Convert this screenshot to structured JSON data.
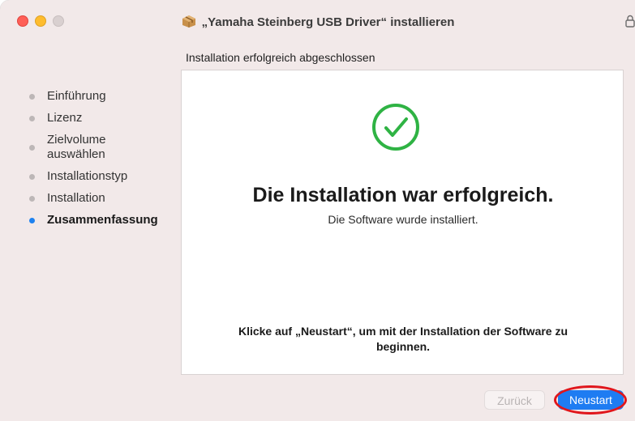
{
  "window": {
    "title": "„Yamaha Steinberg USB Driver“ installieren",
    "package_icon": "package-icon",
    "lock_icon": "lock-icon"
  },
  "subtitle": "Installation erfolgreich abgeschlossen",
  "sidebar": {
    "steps": [
      {
        "label": "Einführung",
        "state": "done"
      },
      {
        "label": "Lizenz",
        "state": "done"
      },
      {
        "label": "Zielvolume auswählen",
        "state": "done"
      },
      {
        "label": "Installationstyp",
        "state": "done"
      },
      {
        "label": "Installation",
        "state": "done"
      },
      {
        "label": "Zusammenfassung",
        "state": "active"
      }
    ]
  },
  "content": {
    "icon": "checkmark-circle-icon",
    "headline": "Die Installation war erfolgreich.",
    "subline": "Die Software wurde installiert.",
    "instruction": "Klicke auf „Neustart“, um mit der Installation der Software zu beginnen."
  },
  "buttons": {
    "back_label": "Zurück",
    "restart_label": "Neustart"
  },
  "colors": {
    "accent": "#1e7cf2",
    "success": "#2fb344",
    "highlight": "#e0161c"
  }
}
